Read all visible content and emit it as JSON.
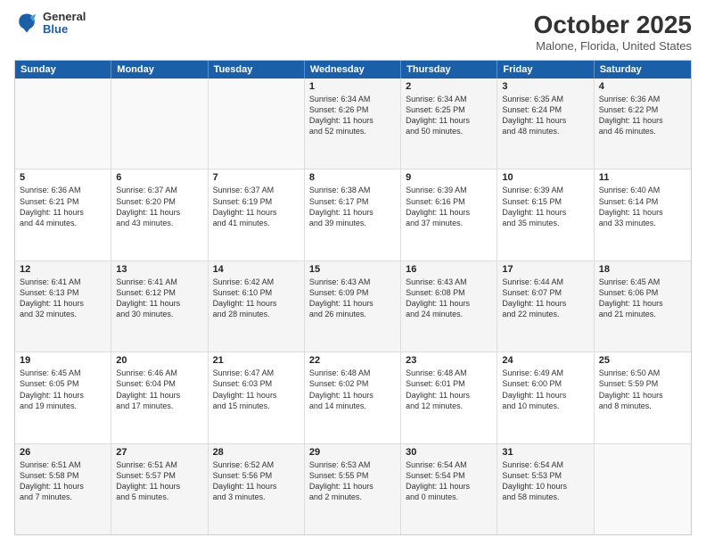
{
  "header": {
    "logo": {
      "general": "General",
      "blue": "Blue"
    },
    "title": "October 2025",
    "location": "Malone, Florida, United States"
  },
  "weekdays": [
    "Sunday",
    "Monday",
    "Tuesday",
    "Wednesday",
    "Thursday",
    "Friday",
    "Saturday"
  ],
  "rows": [
    [
      {
        "day": "",
        "info": "",
        "empty": true
      },
      {
        "day": "",
        "info": "",
        "empty": true
      },
      {
        "day": "",
        "info": "",
        "empty": true
      },
      {
        "day": "1",
        "info": "Sunrise: 6:34 AM\nSunset: 6:26 PM\nDaylight: 11 hours\nand 52 minutes.",
        "empty": false
      },
      {
        "day": "2",
        "info": "Sunrise: 6:34 AM\nSunset: 6:25 PM\nDaylight: 11 hours\nand 50 minutes.",
        "empty": false
      },
      {
        "day": "3",
        "info": "Sunrise: 6:35 AM\nSunset: 6:24 PM\nDaylight: 11 hours\nand 48 minutes.",
        "empty": false
      },
      {
        "day": "4",
        "info": "Sunrise: 6:36 AM\nSunset: 6:22 PM\nDaylight: 11 hours\nand 46 minutes.",
        "empty": false
      }
    ],
    [
      {
        "day": "5",
        "info": "Sunrise: 6:36 AM\nSunset: 6:21 PM\nDaylight: 11 hours\nand 44 minutes.",
        "empty": false
      },
      {
        "day": "6",
        "info": "Sunrise: 6:37 AM\nSunset: 6:20 PM\nDaylight: 11 hours\nand 43 minutes.",
        "empty": false
      },
      {
        "day": "7",
        "info": "Sunrise: 6:37 AM\nSunset: 6:19 PM\nDaylight: 11 hours\nand 41 minutes.",
        "empty": false
      },
      {
        "day": "8",
        "info": "Sunrise: 6:38 AM\nSunset: 6:17 PM\nDaylight: 11 hours\nand 39 minutes.",
        "empty": false
      },
      {
        "day": "9",
        "info": "Sunrise: 6:39 AM\nSunset: 6:16 PM\nDaylight: 11 hours\nand 37 minutes.",
        "empty": false
      },
      {
        "day": "10",
        "info": "Sunrise: 6:39 AM\nSunset: 6:15 PM\nDaylight: 11 hours\nand 35 minutes.",
        "empty": false
      },
      {
        "day": "11",
        "info": "Sunrise: 6:40 AM\nSunset: 6:14 PM\nDaylight: 11 hours\nand 33 minutes.",
        "empty": false
      }
    ],
    [
      {
        "day": "12",
        "info": "Sunrise: 6:41 AM\nSunset: 6:13 PM\nDaylight: 11 hours\nand 32 minutes.",
        "empty": false
      },
      {
        "day": "13",
        "info": "Sunrise: 6:41 AM\nSunset: 6:12 PM\nDaylight: 11 hours\nand 30 minutes.",
        "empty": false
      },
      {
        "day": "14",
        "info": "Sunrise: 6:42 AM\nSunset: 6:10 PM\nDaylight: 11 hours\nand 28 minutes.",
        "empty": false
      },
      {
        "day": "15",
        "info": "Sunrise: 6:43 AM\nSunset: 6:09 PM\nDaylight: 11 hours\nand 26 minutes.",
        "empty": false
      },
      {
        "day": "16",
        "info": "Sunrise: 6:43 AM\nSunset: 6:08 PM\nDaylight: 11 hours\nand 24 minutes.",
        "empty": false
      },
      {
        "day": "17",
        "info": "Sunrise: 6:44 AM\nSunset: 6:07 PM\nDaylight: 11 hours\nand 22 minutes.",
        "empty": false
      },
      {
        "day": "18",
        "info": "Sunrise: 6:45 AM\nSunset: 6:06 PM\nDaylight: 11 hours\nand 21 minutes.",
        "empty": false
      }
    ],
    [
      {
        "day": "19",
        "info": "Sunrise: 6:45 AM\nSunset: 6:05 PM\nDaylight: 11 hours\nand 19 minutes.",
        "empty": false
      },
      {
        "day": "20",
        "info": "Sunrise: 6:46 AM\nSunset: 6:04 PM\nDaylight: 11 hours\nand 17 minutes.",
        "empty": false
      },
      {
        "day": "21",
        "info": "Sunrise: 6:47 AM\nSunset: 6:03 PM\nDaylight: 11 hours\nand 15 minutes.",
        "empty": false
      },
      {
        "day": "22",
        "info": "Sunrise: 6:48 AM\nSunset: 6:02 PM\nDaylight: 11 hours\nand 14 minutes.",
        "empty": false
      },
      {
        "day": "23",
        "info": "Sunrise: 6:48 AM\nSunset: 6:01 PM\nDaylight: 11 hours\nand 12 minutes.",
        "empty": false
      },
      {
        "day": "24",
        "info": "Sunrise: 6:49 AM\nSunset: 6:00 PM\nDaylight: 11 hours\nand 10 minutes.",
        "empty": false
      },
      {
        "day": "25",
        "info": "Sunrise: 6:50 AM\nSunset: 5:59 PM\nDaylight: 11 hours\nand 8 minutes.",
        "empty": false
      }
    ],
    [
      {
        "day": "26",
        "info": "Sunrise: 6:51 AM\nSunset: 5:58 PM\nDaylight: 11 hours\nand 7 minutes.",
        "empty": false
      },
      {
        "day": "27",
        "info": "Sunrise: 6:51 AM\nSunset: 5:57 PM\nDaylight: 11 hours\nand 5 minutes.",
        "empty": false
      },
      {
        "day": "28",
        "info": "Sunrise: 6:52 AM\nSunset: 5:56 PM\nDaylight: 11 hours\nand 3 minutes.",
        "empty": false
      },
      {
        "day": "29",
        "info": "Sunrise: 6:53 AM\nSunset: 5:55 PM\nDaylight: 11 hours\nand 2 minutes.",
        "empty": false
      },
      {
        "day": "30",
        "info": "Sunrise: 6:54 AM\nSunset: 5:54 PM\nDaylight: 11 hours\nand 0 minutes.",
        "empty": false
      },
      {
        "day": "31",
        "info": "Sunrise: 6:54 AM\nSunset: 5:53 PM\nDaylight: 10 hours\nand 58 minutes.",
        "empty": false
      },
      {
        "day": "",
        "info": "",
        "empty": true
      }
    ]
  ]
}
